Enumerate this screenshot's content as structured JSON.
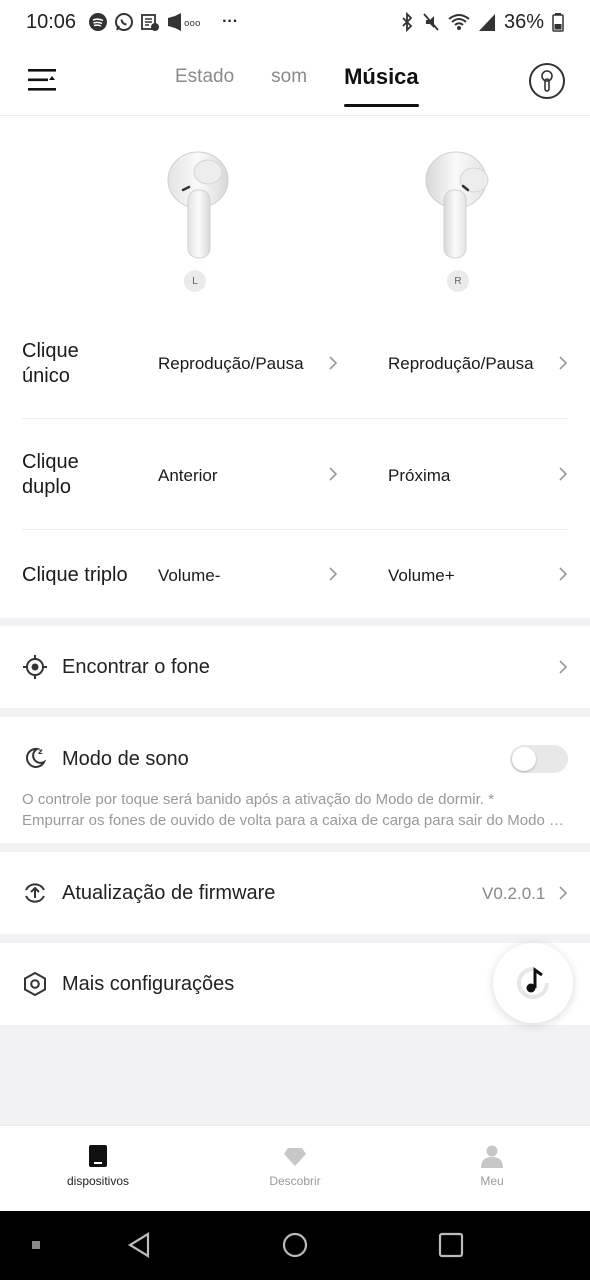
{
  "status_bar": {
    "time": "10:06",
    "notifications": [
      "spotify-icon",
      "whatsapp-icon",
      "reader-icon",
      "megaphone-icon",
      "ellipsis-icon"
    ],
    "battery_percent": "36%",
    "indicators": [
      "bluetooth-icon",
      "mute-icon",
      "wifi-icon",
      "signal-icon",
      "battery-icon"
    ]
  },
  "header": {
    "tabs": [
      {
        "label": "Estado",
        "active": false
      },
      {
        "label": "som",
        "active": false
      },
      {
        "label": "Música",
        "active": true
      }
    ]
  },
  "earbuds": {
    "left_label": "L",
    "right_label": "R"
  },
  "gestures": [
    {
      "name": "Clique único",
      "left_action": "Reprodução/Pausa",
      "right_action": "Reprodução/Pausa"
    },
    {
      "name": "Clique duplo",
      "left_action": "Anterior",
      "right_action": "Próxima"
    },
    {
      "name": "Clique triplo",
      "left_action": "Volume-",
      "right_action": "Volume+"
    }
  ],
  "find_earphone": {
    "label": "Encontrar o fone"
  },
  "sleep_mode": {
    "label": "Modo de sono",
    "enabled": false,
    "description_line1": "O controle por toque será banido após a ativação do Modo de dormir. *",
    "description_line2": "Empurrar os fones de ouvido de volta para a caixa de carga para sair do Modo de dormir."
  },
  "firmware": {
    "label": "Atualização de firmware",
    "version": "V0.2.0.1"
  },
  "more_settings": {
    "label": "Mais configurações"
  },
  "bottom_nav": [
    {
      "label": "dispositivos",
      "icon": "device-icon",
      "active": true
    },
    {
      "label": "Descobrir",
      "icon": "diamond-icon",
      "active": false
    },
    {
      "label": "Meu",
      "icon": "person-icon",
      "active": false
    }
  ],
  "colors": {
    "accent": "#111111",
    "muted": "#8a8a8a",
    "background": "#f2f2f4"
  }
}
